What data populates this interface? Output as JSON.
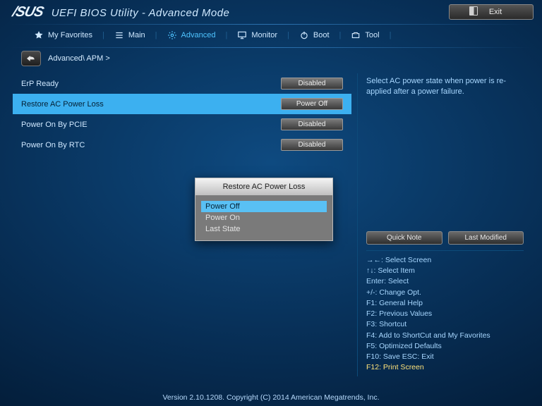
{
  "header": {
    "brand": "/SUS",
    "title": "UEFI BIOS Utility - Advanced Mode",
    "exit": "Exit"
  },
  "menu": {
    "items": [
      {
        "label": "My Favorites",
        "icon": "star"
      },
      {
        "label": "Main",
        "icon": "list"
      },
      {
        "label": "Advanced",
        "icon": "gear",
        "active": true
      },
      {
        "label": "Monitor",
        "icon": "monitor"
      },
      {
        "label": "Boot",
        "icon": "power"
      },
      {
        "label": "Tool",
        "icon": "tool"
      }
    ]
  },
  "breadcrumb": "Advanced\\ APM >",
  "settings": [
    {
      "label": "ErP Ready",
      "value": "Disabled",
      "selected": false
    },
    {
      "label": "Restore AC Power Loss",
      "value": "Power Off",
      "selected": true
    },
    {
      "label": "Power On By PCIE",
      "value": "Disabled",
      "selected": false
    },
    {
      "label": "Power On By RTC",
      "value": "Disabled",
      "selected": false
    }
  ],
  "popup": {
    "title": "Restore AC Power Loss",
    "options": [
      "Power Off",
      "Power On",
      "Last State"
    ],
    "selected": 0
  },
  "help": {
    "text": "Select AC power state when power is re-applied after a power failure."
  },
  "sideButtons": {
    "quickNote": "Quick Note",
    "lastModified": "Last Modified"
  },
  "keys": [
    "→←: Select Screen",
    "↑↓: Select Item",
    "Enter: Select",
    "+/-: Change Opt.",
    "F1: General Help",
    "F2: Previous Values",
    "F3: Shortcut",
    "F4: Add to ShortCut and My Favorites",
    "F5: Optimized Defaults",
    "F10: Save  ESC: Exit",
    "F12: Print Screen"
  ],
  "footer": "Version 2.10.1208. Copyright (C) 2014 American Megatrends, Inc."
}
